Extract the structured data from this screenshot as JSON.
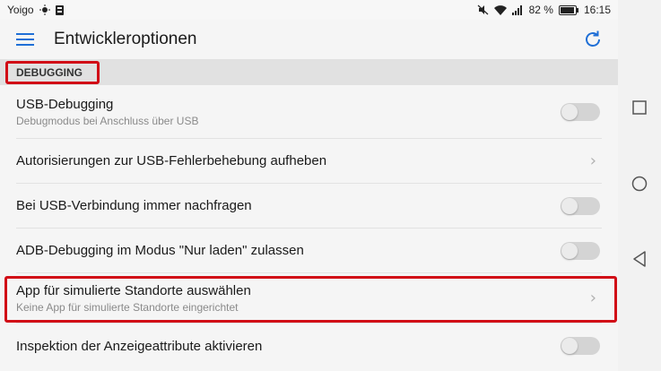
{
  "status_bar": {
    "carrier": "Yoigo",
    "battery": "82 %",
    "time": "16:15"
  },
  "toolbar": {
    "title": "Entwickleroptionen"
  },
  "section": {
    "label": "DEBUGGING"
  },
  "settings": [
    {
      "title": "USB-Debugging",
      "subtitle": "Debugmodus bei Anschluss über USB",
      "control": "toggle",
      "enabled": false
    },
    {
      "title": "Autorisierungen zur USB-Fehlerbehebung aufheben",
      "control": "chevron"
    },
    {
      "title": "Bei USB-Verbindung immer nachfragen",
      "control": "toggle",
      "enabled": false
    },
    {
      "title": "ADB-Debugging im Modus \"Nur laden\" zulassen",
      "control": "toggle",
      "enabled": false
    },
    {
      "title": "App für simulierte Standorte auswählen",
      "subtitle": "Keine App für simulierte Standorte eingerichtet",
      "control": "chevron"
    },
    {
      "title": "Inspektion der Anzeigeattribute aktivieren",
      "control": "toggle",
      "enabled": false
    }
  ],
  "colors": {
    "accent": "#1f6fd6",
    "highlight": "#d10c16"
  }
}
